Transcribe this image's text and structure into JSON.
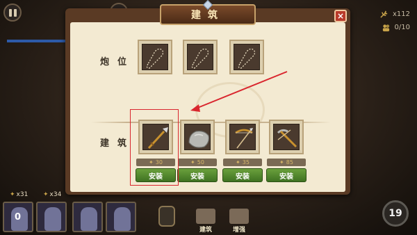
{
  "hud": {
    "resource_count": "x112",
    "population": "0/10",
    "units": [
      {
        "count": "x31"
      },
      {
        "count": "x34"
      }
    ],
    "unit_slot_first_count": "0",
    "wave_number": "19",
    "bottom_tabs": [
      {
        "label": "建筑"
      },
      {
        "label": "增强"
      }
    ]
  },
  "dialog": {
    "title": "建筑",
    "close_icon": "×",
    "cannon_section": {
      "label": "炮位",
      "slots": [
        {
          "icon": "empty-dashed-slot-icon"
        },
        {
          "icon": "empty-dashed-slot-icon"
        },
        {
          "icon": "empty-dashed-slot-icon"
        }
      ]
    },
    "building_section": {
      "label": "建筑",
      "items": [
        {
          "icon": "spear-icon",
          "cost": "30",
          "button": "安装"
        },
        {
          "icon": "stone-icon",
          "cost": "50",
          "button": "安装"
        },
        {
          "icon": "bow-icon",
          "cost": "35",
          "button": "安装"
        },
        {
          "icon": "crossbow-icon",
          "cost": "85",
          "button": "安装"
        }
      ]
    }
  },
  "colors": {
    "install_button": "#4f8a2c",
    "highlight_box": "#d9262e",
    "dialog_paper": "#f3ead2"
  }
}
